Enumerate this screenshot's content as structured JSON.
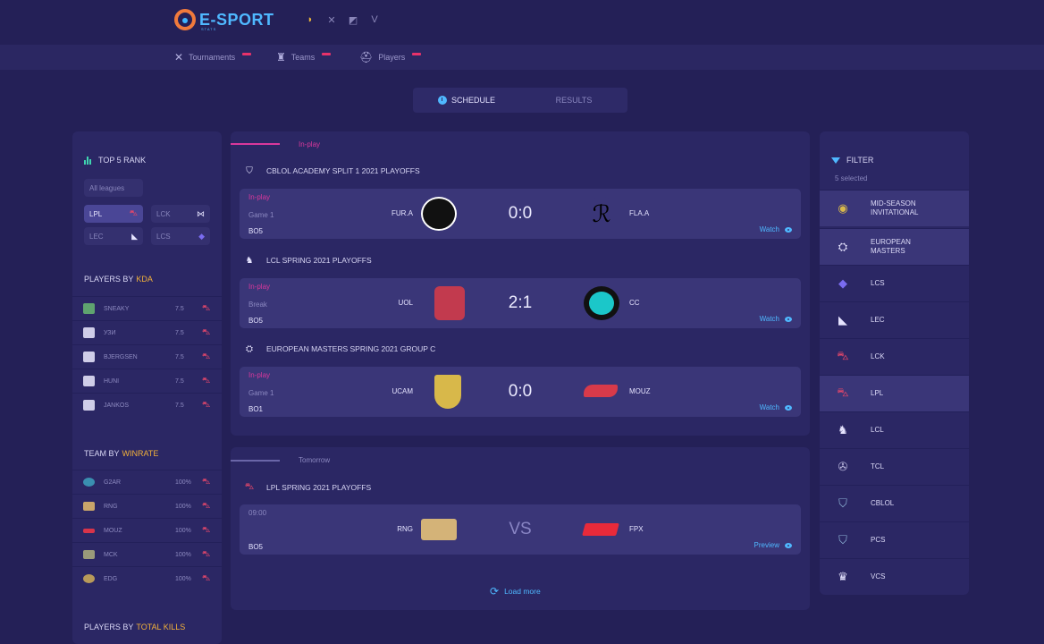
{
  "brand": {
    "name": "E-SPORT",
    "sub": "STATS"
  },
  "game_icons": [
    "lol-icon",
    "csgo-icon",
    "dota-icon",
    "valorant-icon"
  ],
  "nav": [
    {
      "label": "Tournaments",
      "icon": "crossed-swords-icon"
    },
    {
      "label": "Teams",
      "icon": "teams-icon"
    },
    {
      "label": "Players",
      "icon": "player-helmet-icon"
    }
  ],
  "tabs": {
    "schedule": "SCHEDULE",
    "results": "RESULTS"
  },
  "left": {
    "top5_title": "TOP 5 RANK",
    "all_leagues": "All leagues",
    "leagues": [
      "LPL",
      "LCK",
      "LEC",
      "LCS"
    ],
    "players_by": "PLAYERS BY",
    "players_by_hl": "KDA",
    "players": [
      {
        "name": "SNEAKY",
        "value": "7.5"
      },
      {
        "name": "УЗИ",
        "value": "7.5"
      },
      {
        "name": "BJERGSEN",
        "value": "7.5"
      },
      {
        "name": "HUNI",
        "value": "7.5"
      },
      {
        "name": "JANKOS",
        "value": "7.5"
      }
    ],
    "team_by": "TEAM BY",
    "team_by_hl": "WINRATE",
    "teams": [
      {
        "name": "G2AR",
        "value": "100%"
      },
      {
        "name": "RNG",
        "value": "100%"
      },
      {
        "name": "MOUZ",
        "value": "100%"
      },
      {
        "name": "MCK",
        "value": "100%"
      },
      {
        "name": "EDG",
        "value": "100%"
      }
    ],
    "kills_by": "PLAYERS BY",
    "kills_by_hl": "TOTAL KILLS"
  },
  "inplay_label": "In-play",
  "tomorrow_label": "Tomorrow",
  "groups": [
    {
      "league": "CBLOL ACADEMY SPLIT 1 2021 PLAYOFFS",
      "match": {
        "status": "In-play",
        "sub": "Game 1",
        "bo": "BO5",
        "team1": "FUR.A",
        "score": "0:0",
        "team2": "FLA.A",
        "action": "Watch"
      }
    },
    {
      "league": "LCL SPRING 2021 PLAYOFFS",
      "match": {
        "status": "In-play",
        "sub": "Break",
        "bo": "BO5",
        "team1": "UOL",
        "score": "2:1",
        "team2": "CC",
        "action": "Watch"
      }
    },
    {
      "league": "EUROPEAN MASTERS SPRING 2021 GROUP C",
      "match": {
        "status": "In-play",
        "sub": "Game 1",
        "bo": "BO1",
        "team1": "UCAM",
        "score": "0:0",
        "team2": "MOUZ",
        "action": "Watch"
      }
    }
  ],
  "tomorrow": {
    "league": "LPL SPRING 2021 PLAYOFFS",
    "match": {
      "time": "09:00",
      "bo": "BO5",
      "team1": "RNG",
      "score": "VS",
      "team2": "FPX",
      "action": "Preview"
    }
  },
  "load_more": "Load more",
  "filter": {
    "title": "FILTER",
    "sub": "5 selected",
    "items": [
      {
        "label": "MID-SEASON INVITATIONAL",
        "selected": true
      },
      {
        "label": "EUROPEAN MASTERS",
        "selected": true
      },
      {
        "label": "LCS",
        "selected": false
      },
      {
        "label": "LEC",
        "selected": false
      },
      {
        "label": "LCK",
        "selected": false
      },
      {
        "label": "LPL",
        "selected": true
      },
      {
        "label": "LCL",
        "selected": false
      },
      {
        "label": "TCL",
        "selected": false
      },
      {
        "label": "CBLOL",
        "selected": false
      },
      {
        "label": "PCS",
        "selected": false
      },
      {
        "label": "VCS",
        "selected": false
      }
    ]
  },
  "colors": {
    "bg": "#242057",
    "panel": "#2b2764",
    "accent": "#4fb8ff",
    "live": "#d9389c",
    "highlight": "#f2b13a"
  }
}
